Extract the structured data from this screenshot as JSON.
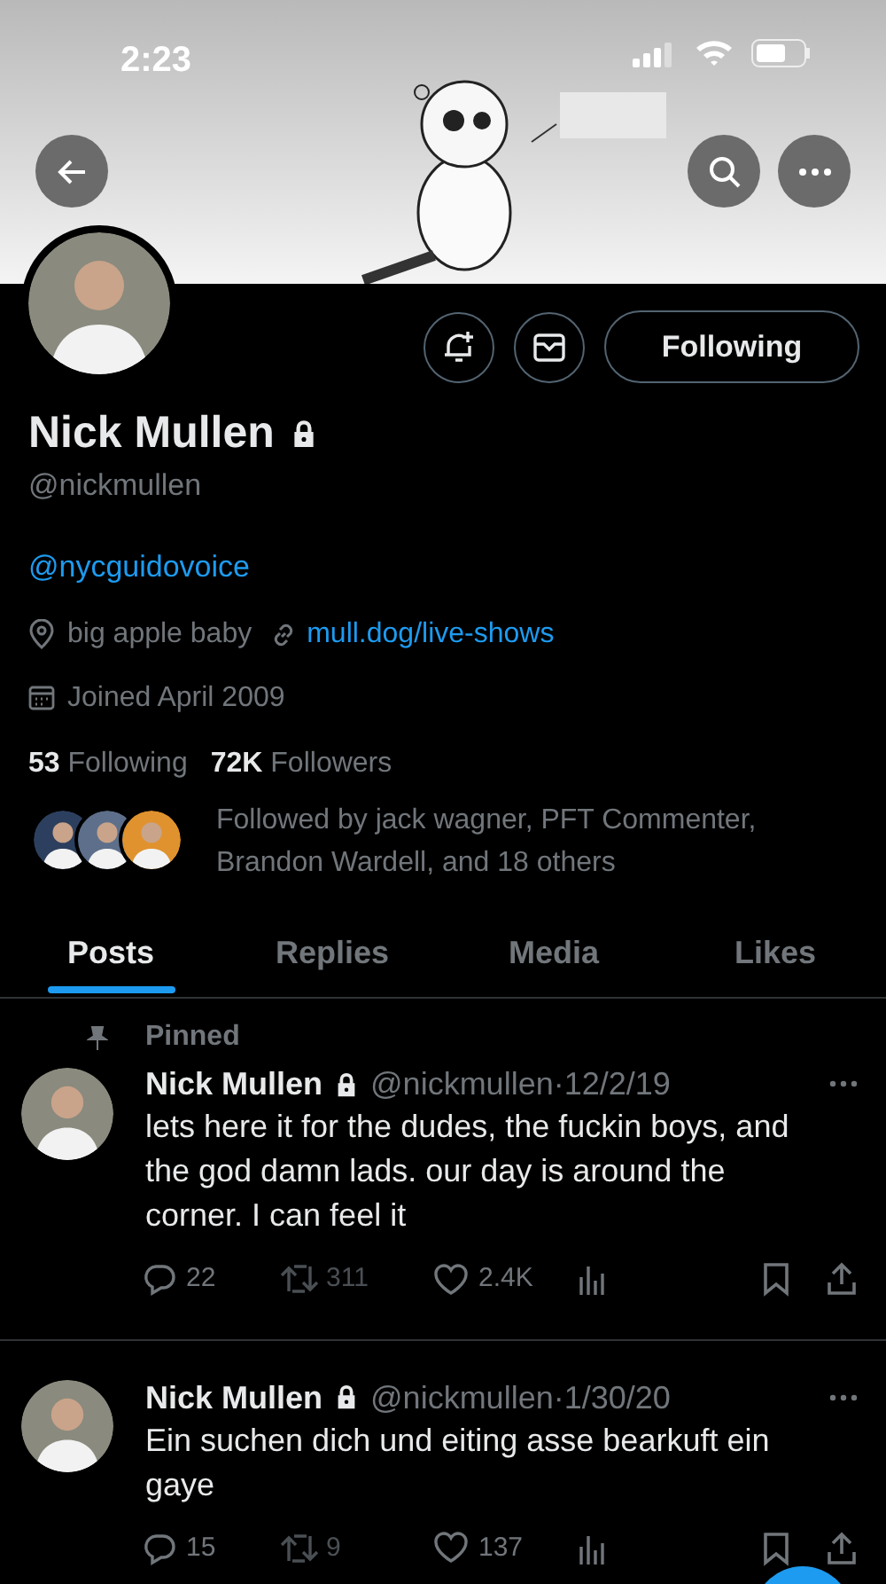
{
  "status_bar": {
    "time": "2:23"
  },
  "profile": {
    "name": "Nick Mullen",
    "protected": true,
    "handle": "@nickmullen",
    "bio_link": "@nycguidovoice",
    "location": "big apple baby",
    "website": "mull.dog/live-shows",
    "joined": "Joined April 2009",
    "following_count": "53",
    "following_label": "Following",
    "followers_count": "72K",
    "followers_label": "Followers",
    "followed_by": "Followed by jack wagner, PFT Commenter, Brandon Wardell, and 18 others"
  },
  "follow_button": {
    "label": "Following"
  },
  "tabs": [
    {
      "label": "Posts",
      "selected": true
    },
    {
      "label": "Replies",
      "selected": false
    },
    {
      "label": "Media",
      "selected": false
    },
    {
      "label": "Likes",
      "selected": false
    }
  ],
  "posts": [
    {
      "pinned": true,
      "pinned_label": "Pinned",
      "name": "Nick Mullen",
      "protected": true,
      "meta": "@nickmullen·12/2/19",
      "text": "lets here it for the dudes, the fuckin boys, and the god damn lads. our day is around the corner. I can feel it",
      "replies": "22",
      "reposts": "311",
      "likes": "2.4K"
    },
    {
      "pinned": false,
      "name": "Nick Mullen",
      "protected": true,
      "meta": "@nickmullen·1/30/20",
      "text": "Ein suchen dich und eiting asse bearkuft ein gaye",
      "replies": "15",
      "reposts": "9",
      "likes": "137"
    }
  ]
}
